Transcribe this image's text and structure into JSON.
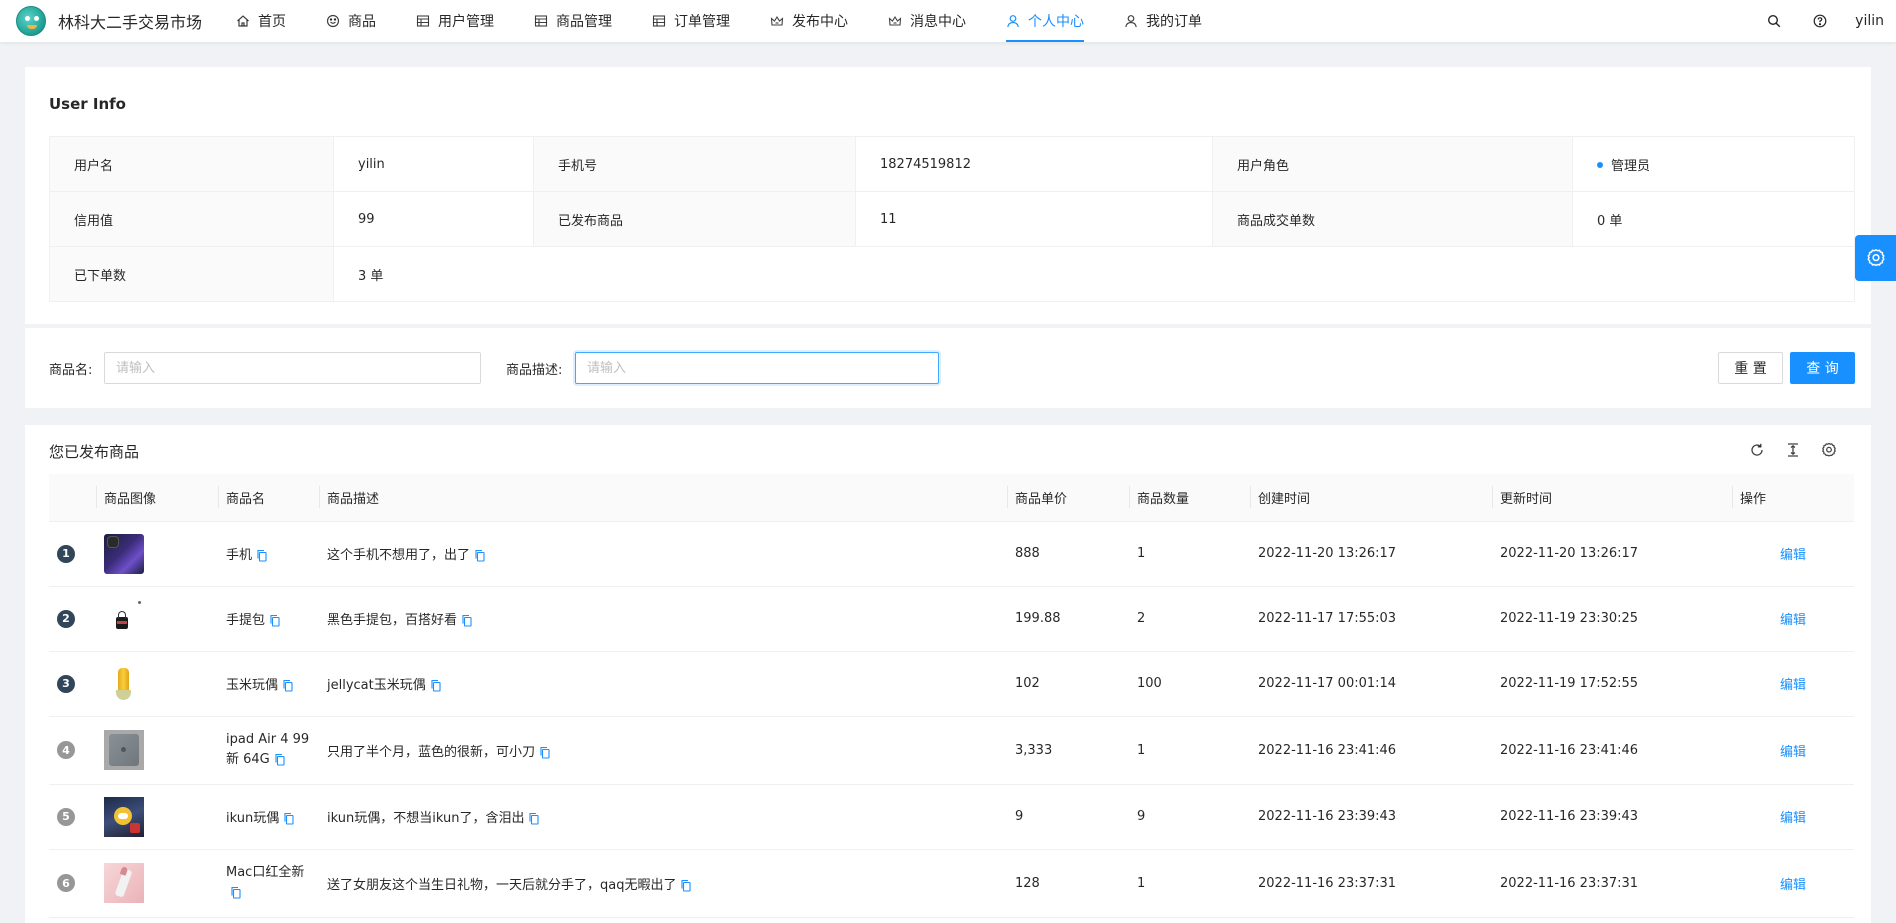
{
  "header": {
    "site_title": "林科大二手交易市场",
    "menu": [
      {
        "label": "首页",
        "icon": "home-icon"
      },
      {
        "label": "商品",
        "icon": "smile-icon"
      },
      {
        "label": "用户管理",
        "icon": "table-icon"
      },
      {
        "label": "商品管理",
        "icon": "table-icon"
      },
      {
        "label": "订单管理",
        "icon": "table-icon"
      },
      {
        "label": "发布中心",
        "icon": "crown-icon"
      },
      {
        "label": "消息中心",
        "icon": "crown-icon"
      },
      {
        "label": "个人中心",
        "icon": "user-icon",
        "active": true
      },
      {
        "label": "我的订单",
        "icon": "user-icon"
      }
    ],
    "username": "yilin",
    "accent_color": "#1890ff"
  },
  "user_info": {
    "title": "User Info",
    "rows": [
      [
        {
          "label": "用户名",
          "value": "yilin"
        },
        {
          "label": "手机号",
          "value": "18274519812"
        },
        {
          "label": "用户角色",
          "value": "管理员"
        }
      ],
      [
        {
          "label": "信用值",
          "value": "99"
        },
        {
          "label": "已发布商品",
          "value": "11"
        },
        {
          "label": "商品成交单数",
          "value": "0 单"
        }
      ],
      [
        {
          "label": "已下单数",
          "value": "3 单"
        }
      ]
    ]
  },
  "search": {
    "name_label": "商品名:",
    "name_placeholder": "请输入",
    "desc_label": "商品描述:",
    "desc_placeholder": "请输入",
    "reset_label": "重 置",
    "query_label": "查 询"
  },
  "goods_table": {
    "title": "您已发布商品",
    "columns": [
      "",
      "商品图像",
      "商品名",
      "商品描述",
      "商品单价",
      "商品数量",
      "创建时间",
      "更新时间",
      "操作"
    ],
    "rows": [
      {
        "index": "1",
        "name": "手机",
        "desc": "这个手机不想用了，出了",
        "price": "888",
        "qty": "1",
        "created": "2022-11-20 13:26:17",
        "updated": "2022-11-20 13:26:17",
        "action": "编辑"
      },
      {
        "index": "2",
        "name": "手提包",
        "desc": "黑色手提包，百搭好看",
        "price": "199.88",
        "qty": "2",
        "created": "2022-11-17 17:55:03",
        "updated": "2022-11-19 23:30:25",
        "action": "编辑"
      },
      {
        "index": "3",
        "name": "玉米玩偶",
        "desc": "jellycat玉米玩偶",
        "price": "102",
        "qty": "100",
        "created": "2022-11-17 00:01:14",
        "updated": "2022-11-19 17:52:55",
        "action": "编辑"
      },
      {
        "index": "4",
        "name": "ipad Air 4 99新 64G",
        "desc": "只用了半个月，蓝色的很新，可小刀",
        "price": "3,333",
        "qty": "1",
        "created": "2022-11-16 23:41:46",
        "updated": "2022-11-16 23:41:46",
        "action": "编辑"
      },
      {
        "index": "5",
        "name": "ikun玩偶",
        "desc": "ikun玩偶，不想当ikun了，含泪出",
        "price": "9",
        "qty": "9",
        "created": "2022-11-16 23:39:43",
        "updated": "2022-11-16 23:39:43",
        "action": "编辑"
      },
      {
        "index": "6",
        "name": "Mac口红全新",
        "desc": "送了女朋友这个当生日礼物，一天后就分手了，qaq无暇出了",
        "price": "128",
        "qty": "1",
        "created": "2022-11-16 23:37:31",
        "updated": "2022-11-16 23:37:31",
        "action": "编辑"
      }
    ]
  }
}
